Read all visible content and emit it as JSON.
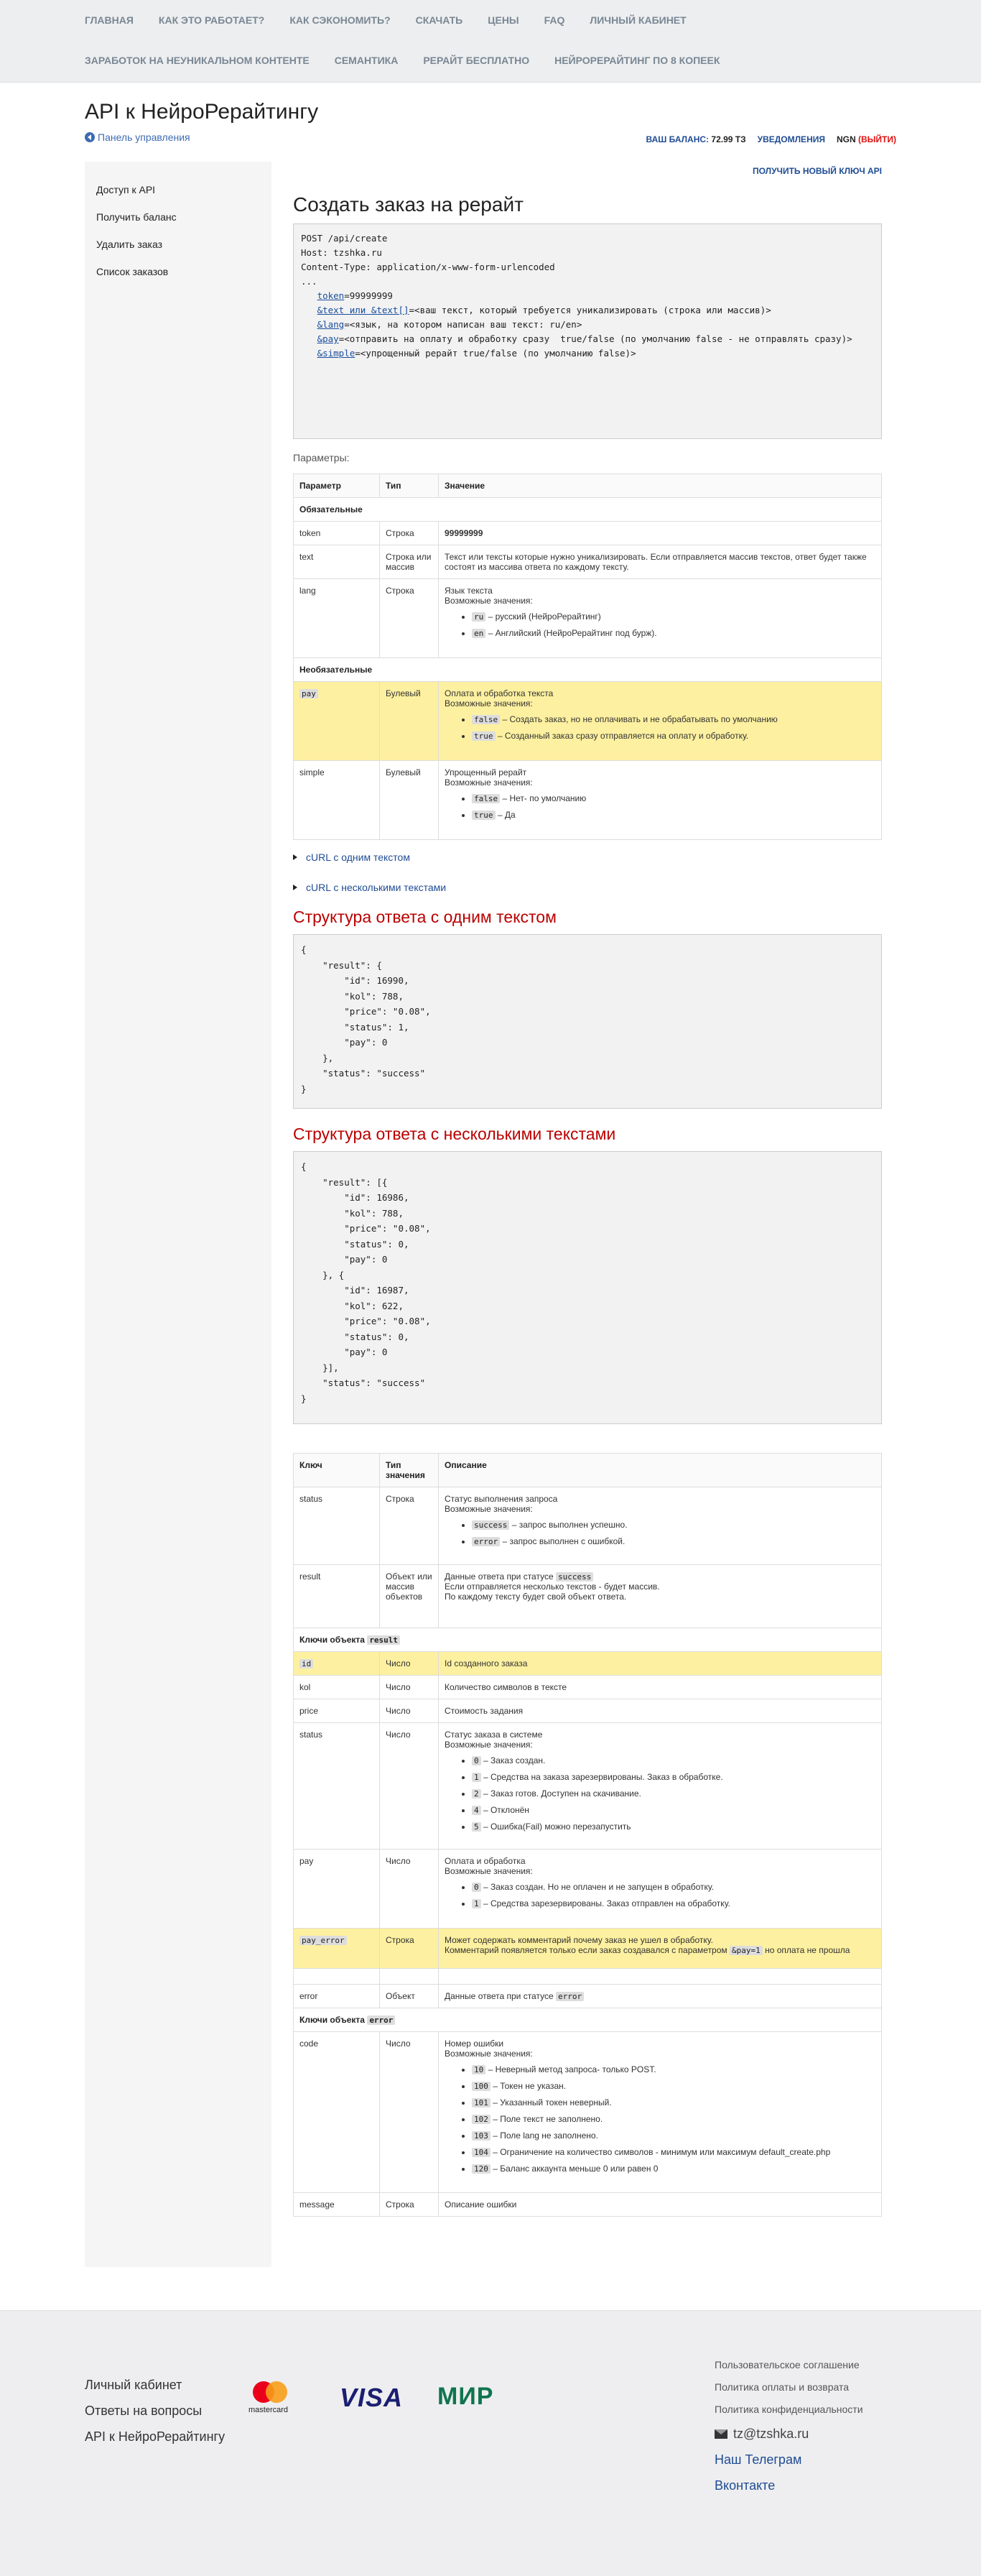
{
  "nav": {
    "row1": [
      "ГЛАВНАЯ",
      "КАК ЭТО РАБОТАЕТ?",
      "КАК СЭКОНОМИТЬ?",
      "СКАЧАТЬ",
      "ЦЕНЫ",
      "FAQ",
      "ЛИЧНЫЙ КАБИНЕТ"
    ],
    "row2": [
      "ЗАРАБОТОК НА НЕУНИКАЛЬНОМ КОНТЕНТЕ",
      "СЕМАНТИКА",
      "РЕРАЙТ БЕСПЛАТНО",
      "НЕЙРОРЕРАЙТИНГ ПО 8 КОПЕЕК"
    ]
  },
  "header": {
    "title": "API к НейроРерайтингу",
    "back": "Панель управления",
    "balance_label": "ВАШ БАЛАНС:",
    "balance_value": "72.99 ТЗ",
    "notifications": "УВЕДОМЛЕНИЯ",
    "user": "NGN",
    "logout": "(ВЫЙТИ)"
  },
  "sidebar": [
    "Доступ к API",
    "Получить баланс",
    "Удалить заказ",
    "Список заказов"
  ],
  "main": {
    "new_key": "ПОЛУЧИТЬ НОВЫЙ КЛЮЧ API",
    "title": "Создать заказ на рерайт",
    "request": {
      "line1": "POST /api/create",
      "line2": "Host: tzshka.ru",
      "line3": "Content-Type: application/x-www-form-urlencoded",
      "line4": "...",
      "p1k": "token",
      "p1v": "=99999999",
      "p2k": "&text или &text[]",
      "p2v": "=<ваш текст, который требуется уникализировать (строка или массив)>",
      "p3k": "&lang",
      "p3v": "=<язык, на котором написан ваш текст: ru/en>",
      "p4k": "&pay",
      "p4v": "=<отправить на оплату и обработку сразу  true/false (по умолчанию false - не отправлять сразу)>",
      "p5k": "&simple",
      "p5v": "=<упрощенный рерайт true/false (по умолчанию false)>"
    },
    "params_label": "Параметры:",
    "params": {
      "headers": [
        "Параметр",
        "Тип",
        "Значение"
      ],
      "required": "Обязательные",
      "optional": "Необязательные",
      "token": {
        "name": "token",
        "type": "Строка",
        "value": "99999999"
      },
      "text": {
        "name": "text",
        "type": "Строка или массив",
        "value": "Текст или тексты которые нужно уникализировать. Если отправляется массив текстов, ответ будет также состоят из массива ответа по каждому тексту."
      },
      "lang": {
        "name": "lang",
        "type": "Строка",
        "value": "Язык текста",
        "possible": "Возможные значения:",
        "o1c": "ru",
        "o1t": " – русский (НейроРерайтинг)",
        "o2c": "en",
        "o2t": " – Английский (НейроРерайтинг под бурж)."
      },
      "pay": {
        "name": "pay",
        "type": "Булевый",
        "value": "Оплата и обработка текста",
        "possible": "Возможные значения:",
        "o1c": "false",
        "o1t": " – Создать заказ, но не оплачивать и не обрабатывать по умолчанию",
        "o2c": "true",
        "o2t": " – Созданный заказ сразу отправляется на оплату и обработку."
      },
      "simple": {
        "name": "simple",
        "type": "Булевый",
        "value": "Упрощенный рерайт",
        "possible": "Возможные значения:",
        "o1c": "false",
        "o1t": " – Нет- по умолчанию",
        "o2c": "true",
        "o2t": " – Да"
      }
    },
    "curl1": "cURL с одним текстом",
    "curl2": "cURL с несколькими текстами",
    "resp1_title": "Структура ответа с одним текстом",
    "resp1": "{\n    \"result\": {\n        \"id\": 16990,\n        \"kol\": 788,\n        \"price\": \"0.08\",\n        \"status\": 1,\n        \"pay\": 0\n    },\n    \"status\": \"success\"\n}",
    "resp2_title": "Структура ответа с несколькими текстами",
    "resp2": "{\n    \"result\": [{\n        \"id\": 16986,\n        \"kol\": 788,\n        \"price\": \"0.08\",\n        \"status\": 0,\n        \"pay\": 0\n    }, {\n        \"id\": 16987,\n        \"kol\": 622,\n        \"price\": \"0.08\",\n        \"status\": 0,\n        \"pay\": 0\n    }],\n    \"status\": \"success\"\n}",
    "keys": {
      "headers": [
        "Ключ",
        "Тип значения",
        "Описание"
      ],
      "status": {
        "name": "status",
        "type": "Строка",
        "d1": "Статус выполнения запроса",
        "possible": "Возможные значения:",
        "o1c": "success",
        "o1t": " – запрос выполнен успешно.",
        "o2c": "error",
        "o2t": " – запрос выполнен с ошибкой."
      },
      "result": {
        "name": "result",
        "type": "Объект или массив объектов",
        "d1a": "Данные ответа при статусе ",
        "d1c": "success",
        "d2": "Если отправляется несколько текстов - будет массив.",
        "d3": "По каждому тексту будет свой объект ответа."
      },
      "result_keys": "Ключи объекта ",
      "result_keys_code": "result",
      "id": {
        "name": "id",
        "type": "Число",
        "desc": "Id созданного заказа"
      },
      "kol": {
        "name": "kol",
        "type": "Число",
        "desc": "Количество символов в тексте"
      },
      "price": {
        "name": "price",
        "type": "Число",
        "desc": "Стоимость задания"
      },
      "ostatus": {
        "name": "status",
        "type": "Число",
        "d1": "Статус заказа в системе",
        "possible": "Возможные значения:",
        "o1c": "0",
        "o1t": " – Заказ создан.",
        "o2c": "1",
        "o2t": " – Средства на заказа зарезервированы. Заказ в обработке.",
        "o3c": "2",
        "o3t": " – Заказ готов. Доступен на скачивание.",
        "o4c": "4",
        "o4t": " – Отклонён",
        "o5c": "5",
        "o5t": " – Ошибка(Fail) можно перезапустить"
      },
      "pay": {
        "name": "pay",
        "type": "Число",
        "d1": "Оплата и обработка",
        "possible": "Возможные значения:",
        "o1c": "0",
        "o1t": " – Заказ создан. Но не оплачен и не запущен в обработку.",
        "o2c": "1",
        "o2t": " – Средства зарезервированы. Заказ отправлен на обработку."
      },
      "pay_error": {
        "name": "pay_error",
        "type": "Строка",
        "d1": "Может содержать комментарий почему заказ не ушел в обработку.",
        "d2a": "Комментарий появляется только если заказ создавался с параметром ",
        "d2c": "&pay=1",
        "d2b": " но оплата не прошла"
      },
      "error": {
        "name": "error",
        "type": "Объект",
        "d1a": "Данные ответа при статусе ",
        "d1c": "error"
      },
      "error_keys": "Ключи объекта ",
      "error_keys_code": "error",
      "code": {
        "name": "code",
        "type": "Число",
        "d1": "Номер ошибки",
        "possible": "Возможные значения:",
        "o1c": "10",
        "o1t": " – Неверный метод запроса- только POST.",
        "o2c": "100",
        "o2t": " – Токен не указан.",
        "o3c": "101",
        "o3t": " – Указанный токен неверный.",
        "o4c": "102",
        "o4t": " – Поле текст не заполнено.",
        "o5c": "103",
        "o5t": " – Поле lang не заполнено.",
        "o6c": "104",
        "o6t": " – Ограничение на количество символов - минимум или максимум default_create.php",
        "o7c": "120",
        "o7t": " – Баланс аккаунта меньше 0 или равен 0"
      },
      "message": {
        "name": "message",
        "type": "Строка",
        "desc": "Описание ошибки"
      }
    }
  },
  "footer": {
    "links1": [
      "Личный кабинет",
      "Ответы на вопросы",
      "API к НейроРерайтингу"
    ],
    "mastercard": "mastercard",
    "visa": "VISA",
    "mir": "МИР",
    "links3": [
      "Пользовательское соглашение",
      "Политика оплаты и возврата",
      "Политика конфиденциальности"
    ],
    "email": "tz@tzshka.ru",
    "telegram": "Наш Телеграм",
    "vk": "Вконтакте"
  }
}
